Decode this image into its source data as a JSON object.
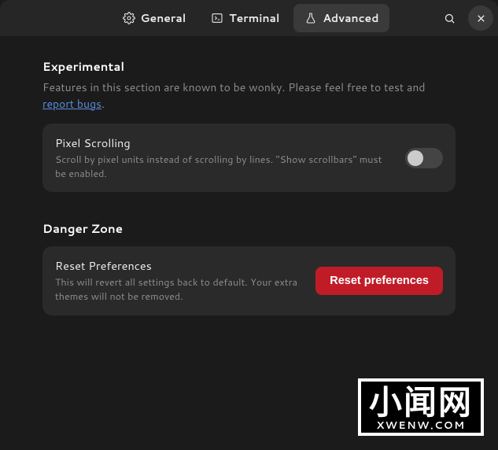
{
  "header": {
    "tabs": [
      {
        "label": "General"
      },
      {
        "label": "Terminal"
      },
      {
        "label": "Advanced"
      }
    ]
  },
  "experimental": {
    "title": "Experimental",
    "subtitle_prefix": "Features in this section are known to be wonky. Please feel free to test and ",
    "subtitle_link": "report bugs",
    "subtitle_suffix": ".",
    "pixel_scrolling": {
      "title": "Pixel Scrolling",
      "desc": "Scroll by pixel units instead of scrolling by lines. \"Show scrollbars\" must be enabled."
    }
  },
  "danger": {
    "title": "Danger Zone",
    "reset": {
      "title": "Reset Preferences",
      "desc": "This will revert all settings back to default. Your extra themes will not be removed.",
      "button": "Reset preferences"
    }
  },
  "watermark": {
    "cn": "小闻网",
    "en": "XWENW.COM"
  }
}
